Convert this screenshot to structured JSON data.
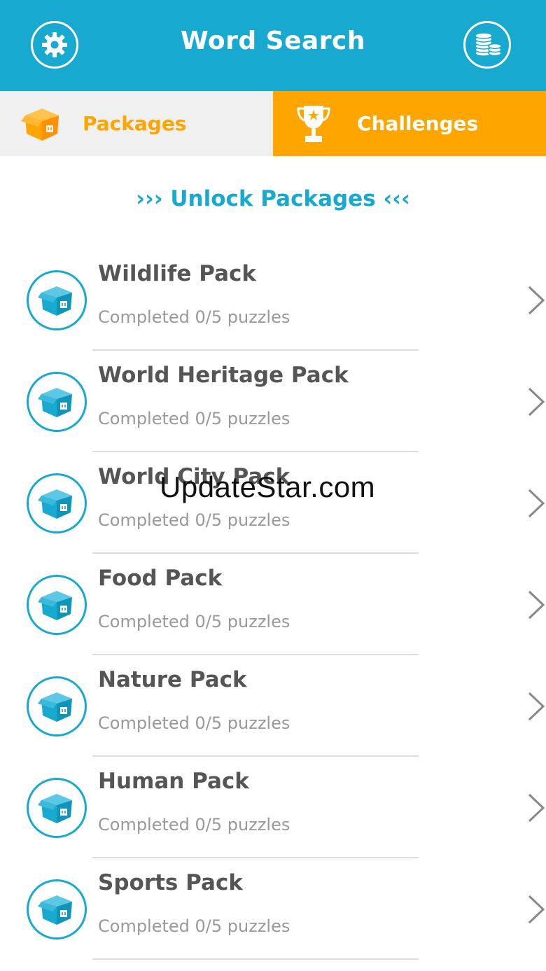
{
  "header": {
    "title": "Word Search",
    "settings_icon": "gear-icon",
    "coins_icon": "coins-icon"
  },
  "tabs": [
    {
      "label": "Packages",
      "icon": "box-icon",
      "active": true
    },
    {
      "label": "Challenges",
      "icon": "trophy-icon",
      "active": false
    }
  ],
  "unlock_label": "››› Unlock Packages ‹‹‹",
  "packages": [
    {
      "name": "Wildlife Pack",
      "progress": "Completed 0/5 puzzles"
    },
    {
      "name": "World Heritage Pack",
      "progress": "Completed 0/5 puzzles"
    },
    {
      "name": "World City Pack",
      "progress": "Completed 0/5 puzzles"
    },
    {
      "name": "Food Pack",
      "progress": "Completed 0/5 puzzles"
    },
    {
      "name": "Nature Pack",
      "progress": "Completed 0/5 puzzles"
    },
    {
      "name": "Human Pack",
      "progress": "Completed 0/5 puzzles"
    },
    {
      "name": "Sports Pack",
      "progress": "Completed 0/5 puzzles"
    }
  ],
  "watermark": "UpdateStar.com",
  "colors": {
    "primary": "#17a9cf",
    "accent": "#ffa500",
    "tab_inactive_bg": "#f0f0f0",
    "text_dark": "#555555",
    "text_muted": "#999999"
  }
}
